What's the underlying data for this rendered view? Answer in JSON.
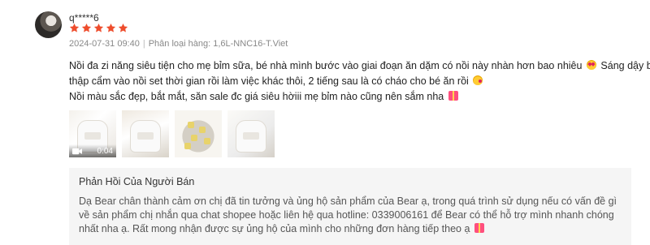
{
  "review": {
    "username": "q*****6",
    "rating": 5,
    "star_color": "#ee4d2d",
    "date": "2024-07-31 09:40",
    "separator": "|",
    "variation_label": "Phân loại hàng:",
    "variation_value": "1,6L-NNC16-T.Viet",
    "content": {
      "line1": "Nồi đa zi năng siêu tiện cho mẹ bỉm sữa, bé nhà mình bước vào giai đoạn ăn dặm có nồi này nhàn hơn bao nhiêu",
      "line1_end": "Sáng dậy bỏ",
      "line2": "thập cẩm vào nồi set thời gian rồi làm việc khác thôi, 2 tiếng sau là có cháo cho bé ăn rồi",
      "line3": "Nồi màu sắc đẹp, bắt mắt, săn sale đc giá siêu hờiii mẹ bỉm nào cũng nên sắm nha"
    },
    "emojis": [
      "smiling-face-heart-eyes",
      "face-blowing-kiss",
      "gift-heart"
    ],
    "media": [
      {
        "type": "video",
        "duration": "0:04",
        "icon": "video-camera-icon"
      },
      {
        "type": "image"
      },
      {
        "type": "image"
      },
      {
        "type": "image"
      }
    ]
  },
  "seller_reply": {
    "title": "Phản Hồi Của Người Bán",
    "text": "Dạ Bear chân thành cảm ơn chị đã tin tưởng và ủng hộ sản phẩm của Bear ạ, trong quá trình sử dụng nếu có vấn đề gì về sản phẩm chị nhắn qua chat shopee hoặc liên hệ qua hotline: 0339006161 để Bear có thể hỗ trợ mình nhanh chóng nhất nha ạ. Rất mong nhận được sự ủng hộ của mình cho những đơn hàng tiếp theo ạ",
    "emoji": "gift-heart",
    "background": "#f5f5f5"
  }
}
